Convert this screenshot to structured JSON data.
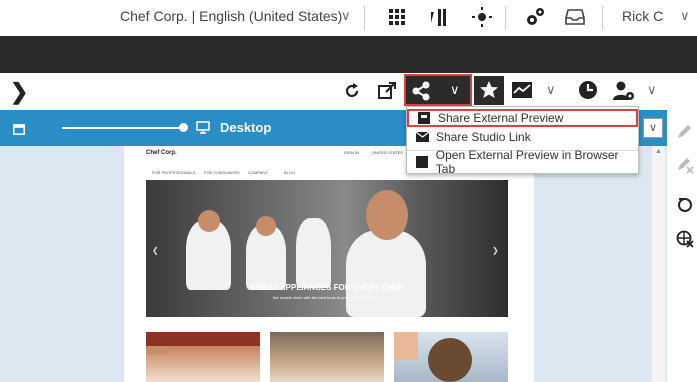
{
  "header": {
    "context_label": "Chef Corp. | English (United States)",
    "user_name": "Rick C"
  },
  "toolbar": {
    "icons": [
      "refresh-icon",
      "open-external-icon",
      "share-icon",
      "chevron-down-icon",
      "star-icon",
      "chart-icon",
      "clock-icon",
      "user-settings-icon"
    ]
  },
  "preview": {
    "device_label": "Desktop",
    "site": {
      "brand": "Chef Corp.",
      "signin": "SIGN IN",
      "locale": "UNITED STATES",
      "nav": [
        "FOR PROFESSIONALS",
        "FOR CONSUMERS",
        "COMPANY",
        "BLOG"
      ],
      "hero_title": "GREAT APPLIANCES FOR EVERY CHEF",
      "hero_subtitle": "We enable chefs with the best tools to prepare perfect meals."
    }
  },
  "share_menu": {
    "items": [
      {
        "label": "Share External Preview",
        "icon": "external-preview-icon"
      },
      {
        "label": "Share Studio Link",
        "icon": "envelope-icon"
      },
      {
        "label": "Open External Preview in Browser Tab",
        "icon": "square-icon"
      }
    ]
  },
  "colors": {
    "accent": "#2a8dc6",
    "dark": "#2b2b2b",
    "highlight": "#d9423d"
  }
}
